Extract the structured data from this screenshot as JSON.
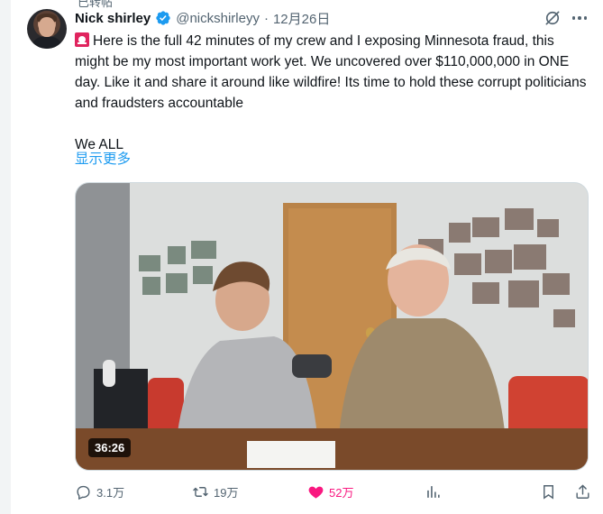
{
  "top_fragment": "已转帖",
  "author": {
    "name": "Nick shirley",
    "handle": "@nickshirleyy",
    "separator": "·",
    "date": "12月26日"
  },
  "icons": {
    "verified": "verified-badge-icon",
    "grok": "grok-icon",
    "more": "more-icon",
    "siren": "siren-emoji-icon"
  },
  "tweet": {
    "text_main": "Here is the full 42 minutes of my crew and I exposing Minnesota fraud, this might be my most important work yet. We uncovered over $110,000,000 in ONE day. Like it and share it around like wildfire! Its time to hold these corrupt politicians and fraudsters accountable",
    "text_tail": "We ALL",
    "show_more": "显示更多"
  },
  "media": {
    "duration": "36:26"
  },
  "actions": {
    "replies": "3.1万",
    "retweets": "19万",
    "likes": "52万"
  },
  "colors": {
    "accent": "#1d9bf0",
    "like": "#f91880",
    "muted": "#536471"
  }
}
